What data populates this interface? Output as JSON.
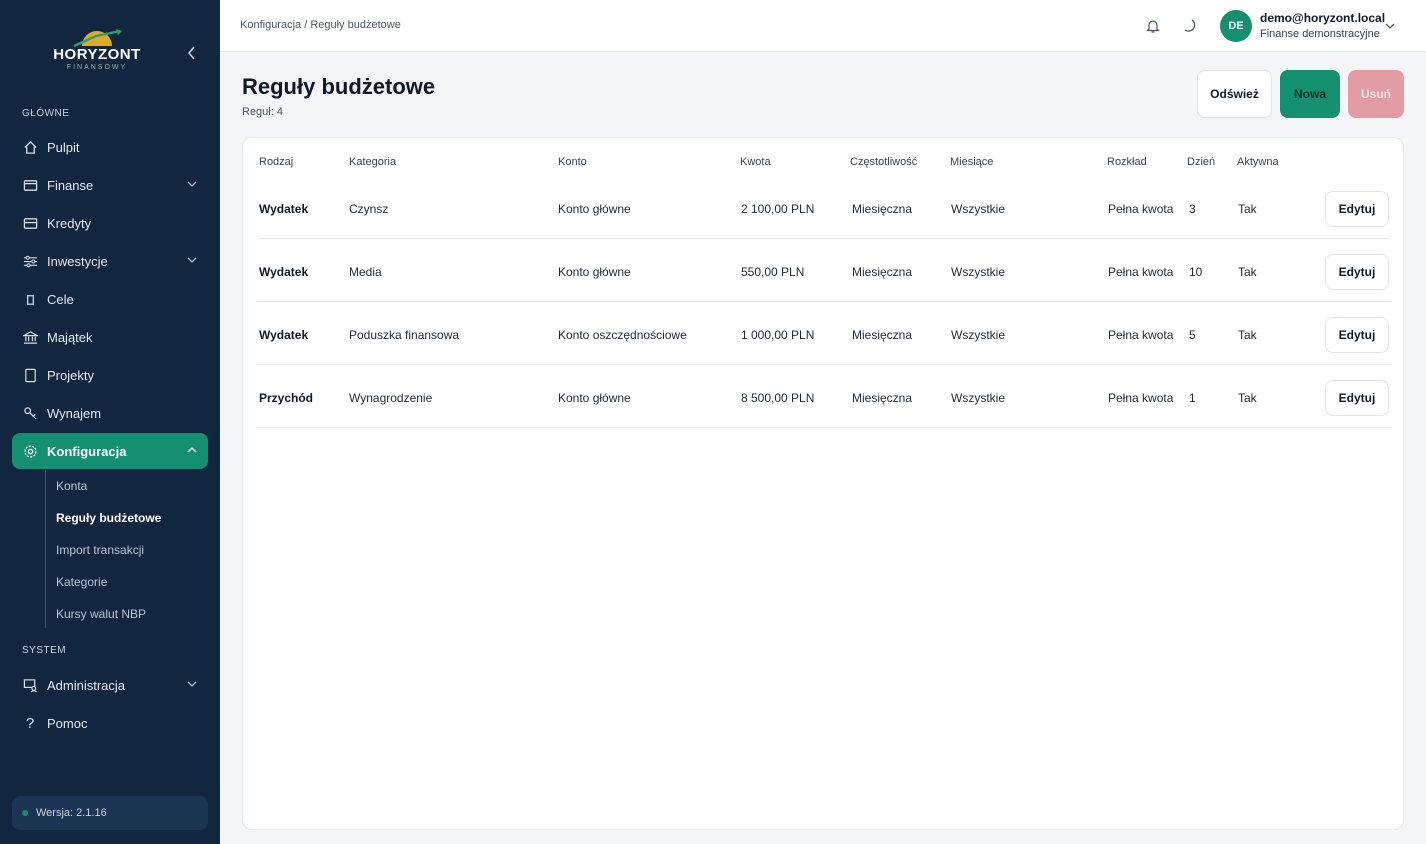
{
  "brand": {
    "name": "HORYZONT",
    "tagline": "FINANSOWY"
  },
  "sidebar": {
    "sections": [
      {
        "label": "GŁÓWNE"
      },
      {
        "label": "SYSTEM"
      }
    ],
    "items": [
      {
        "label": "Pulpit",
        "icon": "home-icon"
      },
      {
        "label": "Finanse",
        "icon": "wallet-icon"
      },
      {
        "label": "Kredyty",
        "icon": "credit-card-icon"
      },
      {
        "label": "Inwestycje",
        "icon": "sliders-icon"
      },
      {
        "label": "Cele",
        "icon": "target-icon"
      },
      {
        "label": "Majątek",
        "icon": "bank-icon"
      },
      {
        "label": "Projekty",
        "icon": "folder-icon"
      },
      {
        "label": "Wynajem",
        "icon": "key-icon"
      },
      {
        "label": "Konfiguracja",
        "icon": "gear-icon"
      },
      {
        "label": "Administracja",
        "icon": "admin-icon"
      },
      {
        "label": "Pomoc",
        "icon": "help-icon"
      }
    ],
    "subitems": [
      {
        "label": "Konta"
      },
      {
        "label": "Reguły budżetowe"
      },
      {
        "label": "Import transakcji"
      },
      {
        "label": "Kategorie"
      },
      {
        "label": "Kursy walut NBP"
      }
    ],
    "version": "Wersja: 2.1.16"
  },
  "topbar": {
    "breadcrumb": "Konfiguracja / Reguły budżetowe",
    "user": {
      "initials": "DE",
      "email": "demo@horyzont.local",
      "org": "Finanse demonstracyjne"
    }
  },
  "page": {
    "title": "Reguły budżetowe",
    "subtitle": "Reguł: 4",
    "buttons": {
      "refresh": "Odśwież",
      "new": "Nowa",
      "delete": "Usuń"
    }
  },
  "table": {
    "headers": [
      "Rodzaj",
      "Kategoria",
      "Konto",
      "Kwota",
      "Częstotliwość",
      "Miesiące",
      "Rozkład",
      "Dzień",
      "Aktywna"
    ],
    "edit_label": "Edytuj",
    "rows": [
      [
        "Wydatek",
        "Czynsz",
        "Konto główne",
        "2 100,00 PLN",
        "Miesięczna",
        "Wszystkie",
        "Pełna kwota",
        "3",
        "Tak"
      ],
      [
        "Wydatek",
        "Media",
        "Konto główne",
        "550,00 PLN",
        "Miesięczna",
        "Wszystkie",
        "Pełna kwota",
        "10",
        "Tak"
      ],
      [
        "Wydatek",
        "Poduszka finansowa",
        "Konto oszczędnościowe",
        "1 000,00 PLN",
        "Miesięczna",
        "Wszystkie",
        "Pełna kwota",
        "5",
        "Tak"
      ],
      [
        "Przychód",
        "Wynagrodzenie",
        "Konto główne",
        "8 500,00 PLN",
        "Miesięczna",
        "Wszystkie",
        "Pełna kwota",
        "1",
        "Tak"
      ]
    ]
  },
  "colors": {
    "sidebar_bg": "#12263f",
    "accent": "#14906f",
    "danger_disabled": "#e39ba4"
  }
}
